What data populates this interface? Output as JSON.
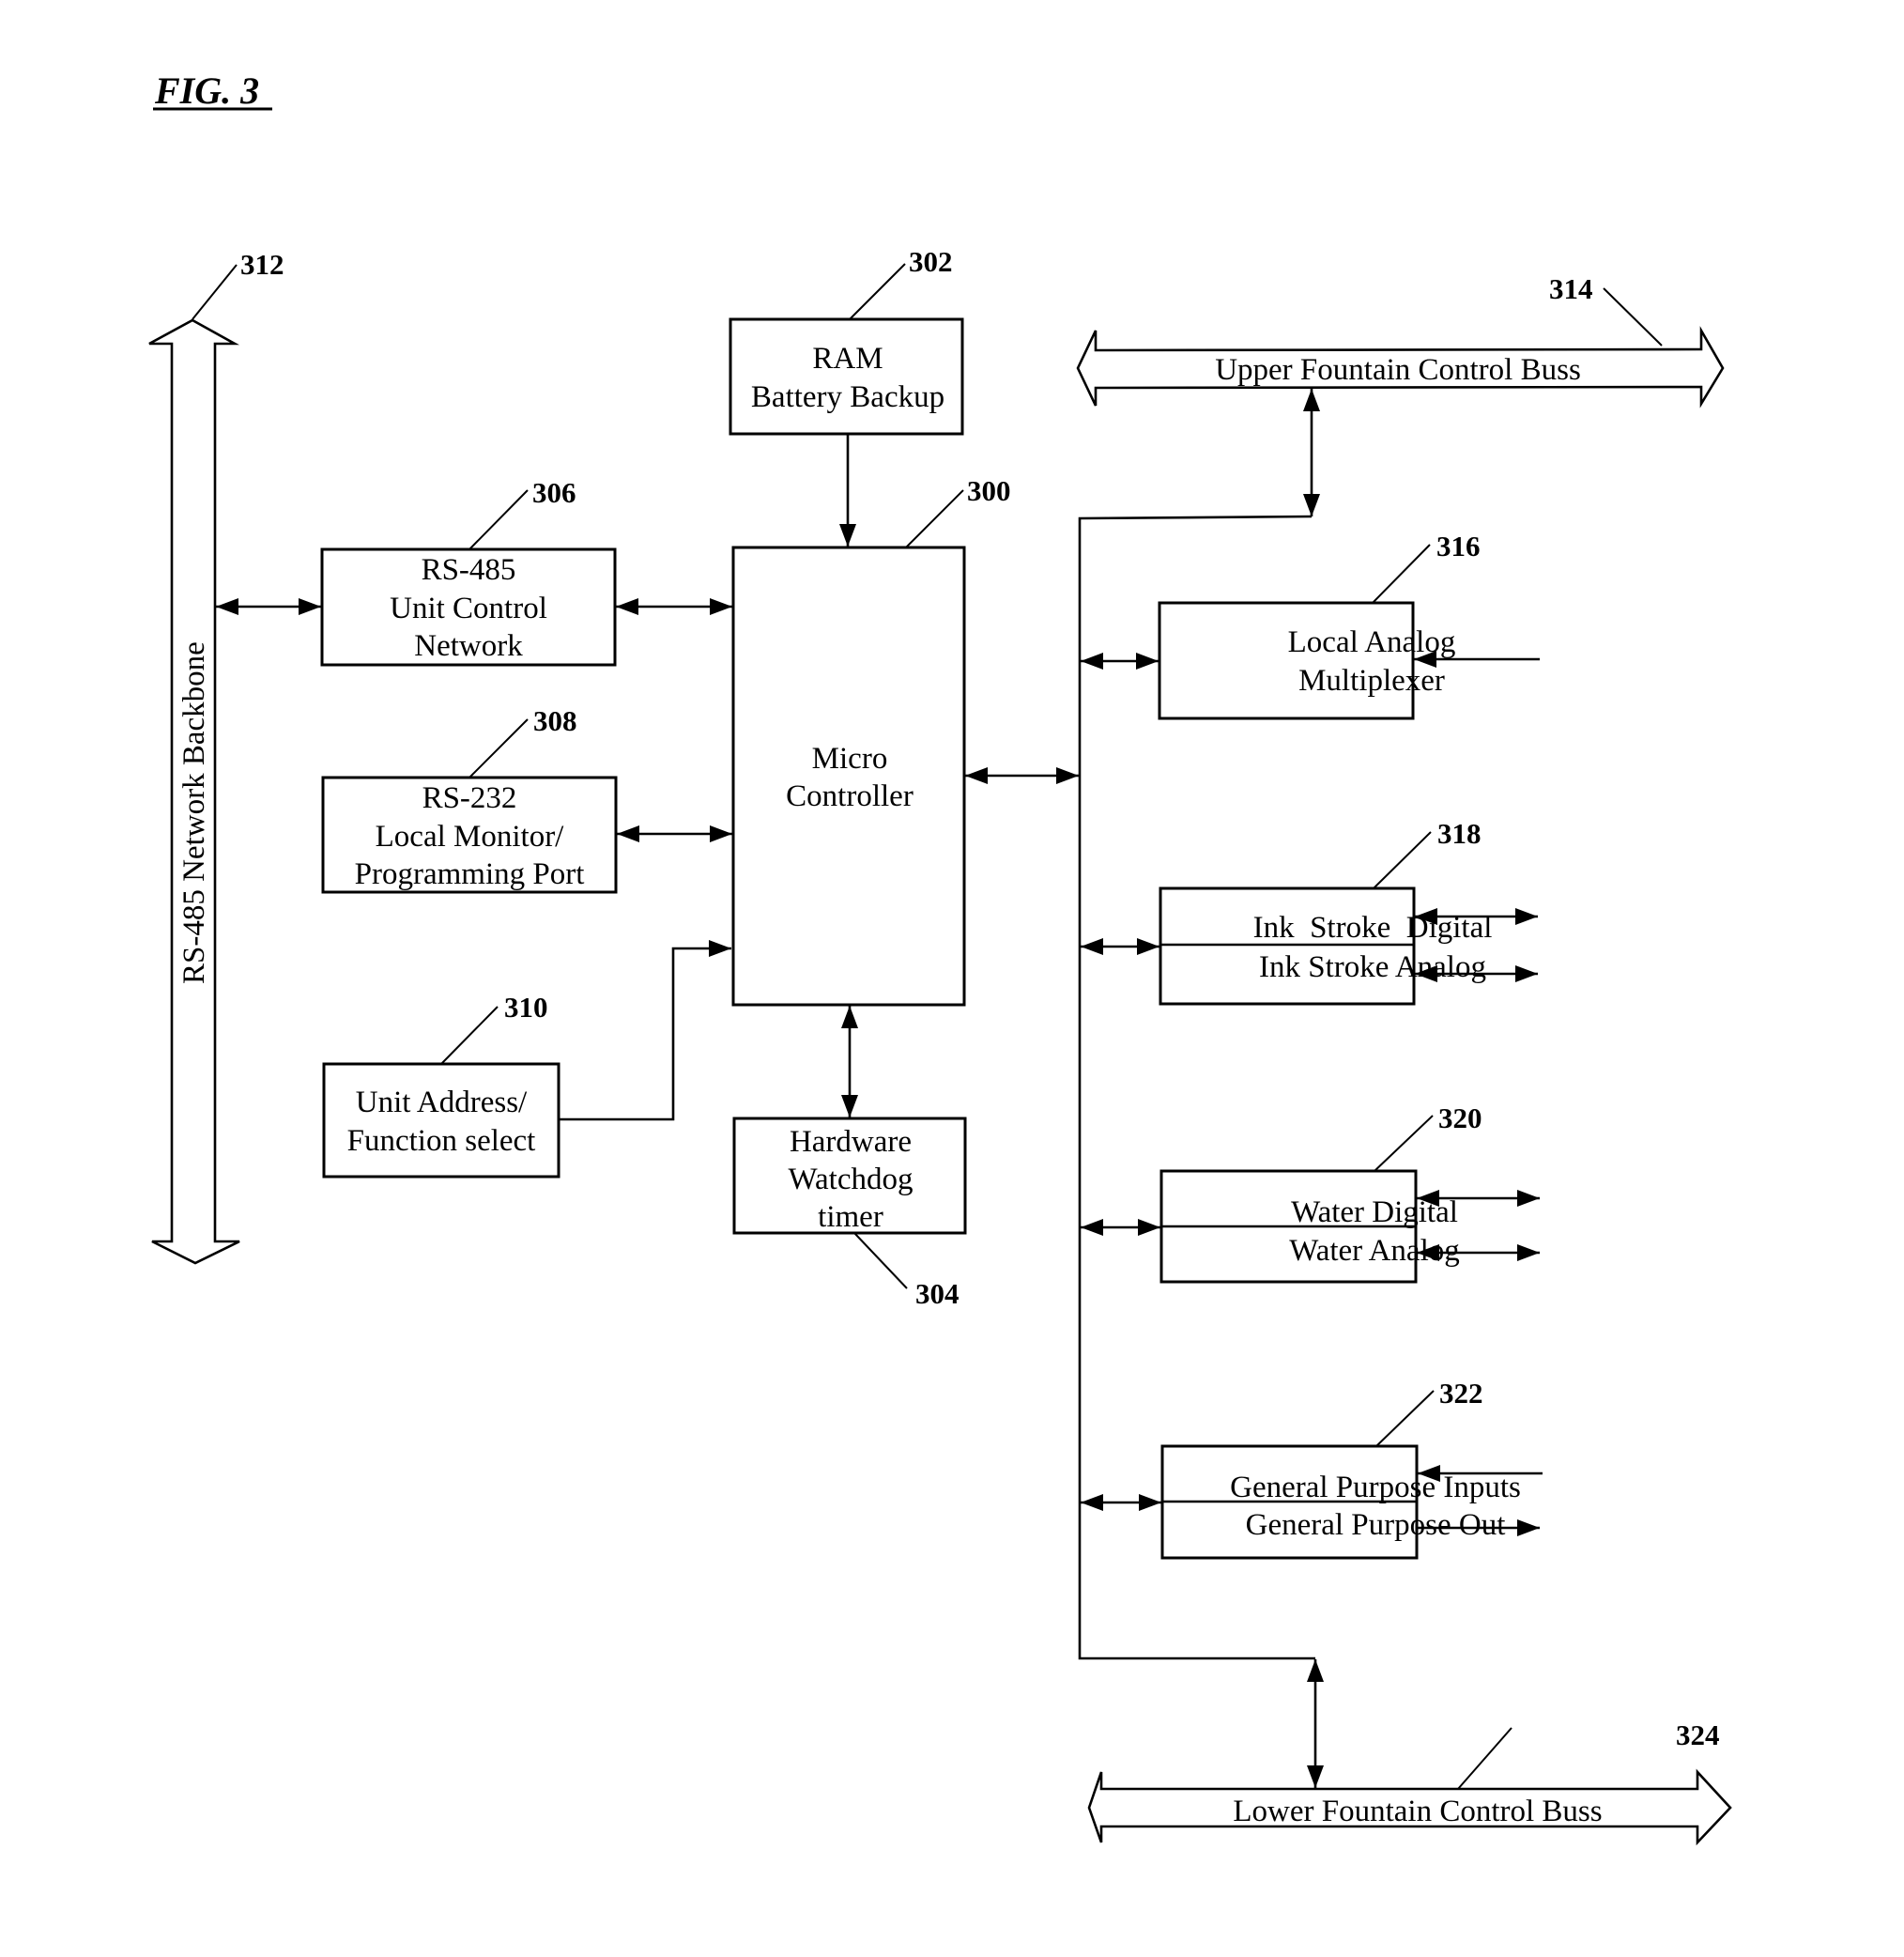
{
  "figure": {
    "title": "FIG. 3"
  },
  "backbone": {
    "label": "RS-485 Network Backbone",
    "ref": "312"
  },
  "blocks": {
    "micro": {
      "ref": "300",
      "lines": [
        "Micro",
        "Controller"
      ]
    },
    "ram": {
      "ref": "302",
      "lines": [
        "RAM",
        "Battery Backup"
      ]
    },
    "watchdog": {
      "ref": "304",
      "lines": [
        "Hardware",
        "Watchdog",
        "timer"
      ]
    },
    "rs485": {
      "ref": "306",
      "lines": [
        "RS-485",
        "Unit Control",
        "Network"
      ]
    },
    "rs232": {
      "ref": "308",
      "lines": [
        "RS-232",
        "Local Monitor/",
        "Programming Port"
      ]
    },
    "address": {
      "ref": "310",
      "lines": [
        "Unit Address/",
        "Function select"
      ]
    },
    "analog_mux": {
      "ref": "316",
      "lines": [
        "Local Analog",
        "Multiplexer"
      ]
    },
    "ink": {
      "ref": "318",
      "lines": [
        "Ink  Stroke  Digital",
        "Ink Stroke Analog"
      ]
    },
    "water": {
      "ref": "320",
      "lines": [
        "Water Digital",
        "Water Analog"
      ]
    },
    "gp": {
      "ref": "322",
      "lines": [
        "General Purpose Inputs",
        "General Purpose Out"
      ]
    }
  },
  "busses": {
    "upper": {
      "ref": "314",
      "label": "Upper Fountain Control Buss"
    },
    "lower": {
      "ref": "324",
      "label": "Lower Fountain Control Buss"
    }
  }
}
